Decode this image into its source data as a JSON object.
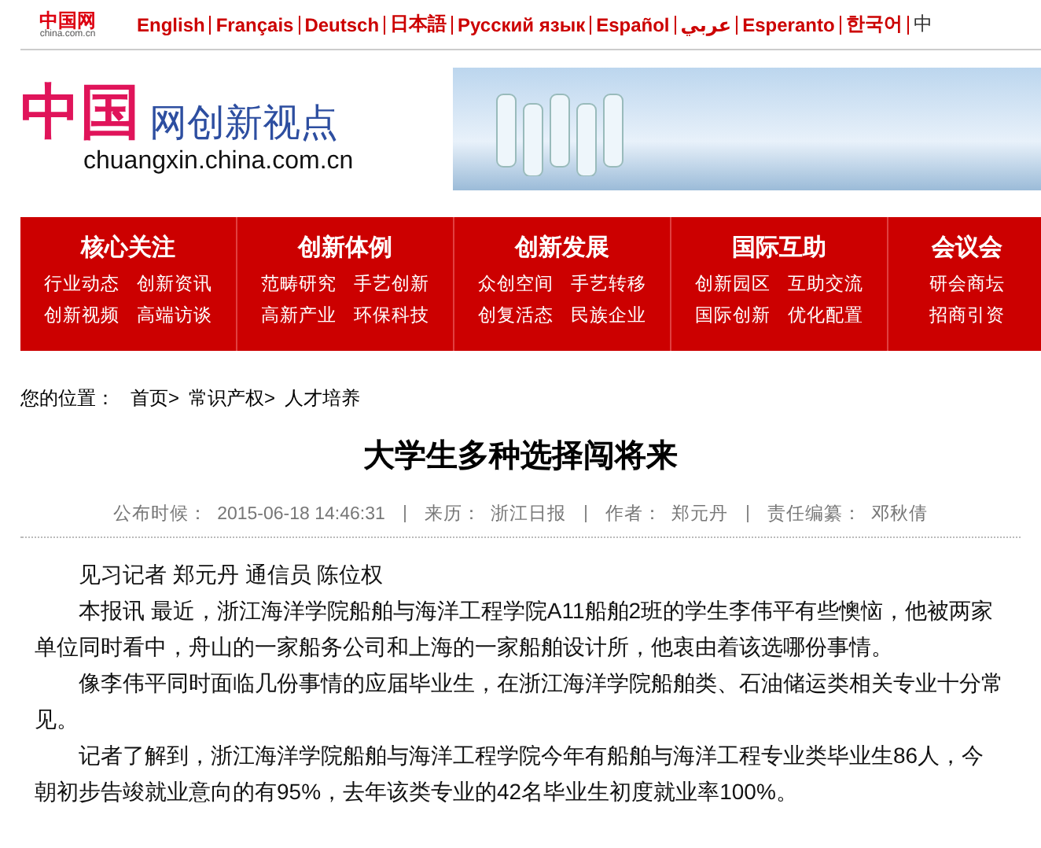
{
  "top_bar": {
    "logo_text": "中国网",
    "logo_sub": "china.com.cn",
    "languages": [
      "English",
      "Français",
      "Deutsch",
      "日本語",
      "Русский язык",
      "Español",
      "عربي",
      "Esperanto",
      "한국어",
      "中"
    ]
  },
  "header": {
    "logo_mark": "中国",
    "logo_title": "网创新视点",
    "logo_url": "chuangxin.china.com.cn"
  },
  "nav": [
    {
      "title": "核心关注",
      "links": [
        "行业动态",
        "创新资讯",
        "创新视频",
        "高端访谈"
      ]
    },
    {
      "title": "创新体例",
      "links": [
        "范畴研究",
        "手艺创新",
        "高新产业",
        "环保科技"
      ]
    },
    {
      "title": "创新发展",
      "links": [
        "众创空间",
        "手艺转移",
        "创复活态",
        "民族企业"
      ]
    },
    {
      "title": "国际互助",
      "links": [
        "创新园区",
        "互助交流",
        "国际创新",
        "优化配置"
      ]
    },
    {
      "title": "会议会",
      "links": [
        "研会商坛",
        "招商引资"
      ]
    }
  ],
  "breadcrumb": {
    "label": "您的位置：",
    "items": [
      "首页>",
      "常识产权>",
      "人才培养"
    ]
  },
  "article": {
    "title": "大学生多种选择闯将来",
    "meta": [
      {
        "label": "公布时候：",
        "value": "2015-06-18 14:46:31"
      },
      {
        "label": "来历：",
        "value": "浙江日报"
      },
      {
        "label": "作者：",
        "value": "郑元丹"
      },
      {
        "label": "责任编纂：",
        "value": "邓秋倩"
      }
    ],
    "paragraphs": [
      "见习记者 郑元丹 通信员 陈位权",
      "本报讯 最近，浙江海洋学院船舶与海洋工程学院A11船舶2班的学生李伟平有些懊恼，他被两家单位同时看中，舟山的一家船务公司和上海的一家船舶设计所，他衷由着该选哪份事情。",
      "像李伟平同时面临几份事情的应届毕业生，在浙江海洋学院船舶类、石油储运类相关专业十分常见。",
      "记者了解到，浙江海洋学院船舶与海洋工程学院今年有船舶与海洋工程专业类毕业生86人，今朝初步告竣就业意向的有95%，去年该类专业的42名毕业生初度就业率100%。"
    ]
  }
}
